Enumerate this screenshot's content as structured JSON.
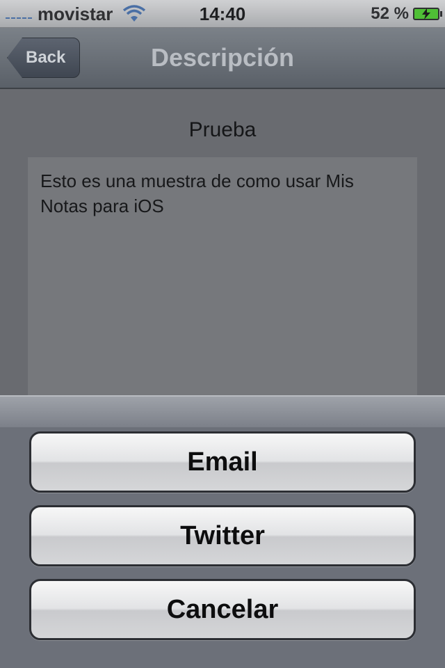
{
  "status_bar": {
    "carrier": "movistar",
    "time": "14:40",
    "battery_percent": "52 %",
    "battery_level": 0.52,
    "icons": [
      "signal-icon",
      "wifi-icon",
      "battery-charging-icon"
    ]
  },
  "nav": {
    "back_label": "Back",
    "title": "Descripción"
  },
  "note": {
    "title": "Prueba",
    "body": "Esto es una muestra de como usar Mis Notas para iOS"
  },
  "action_sheet": {
    "buttons": [
      "Email",
      "Twitter",
      "Cancelar"
    ]
  },
  "colors": {
    "nav_bar": "#6a7078",
    "battery_fill": "#4fbf36",
    "action_sheet": "#6c7079"
  }
}
